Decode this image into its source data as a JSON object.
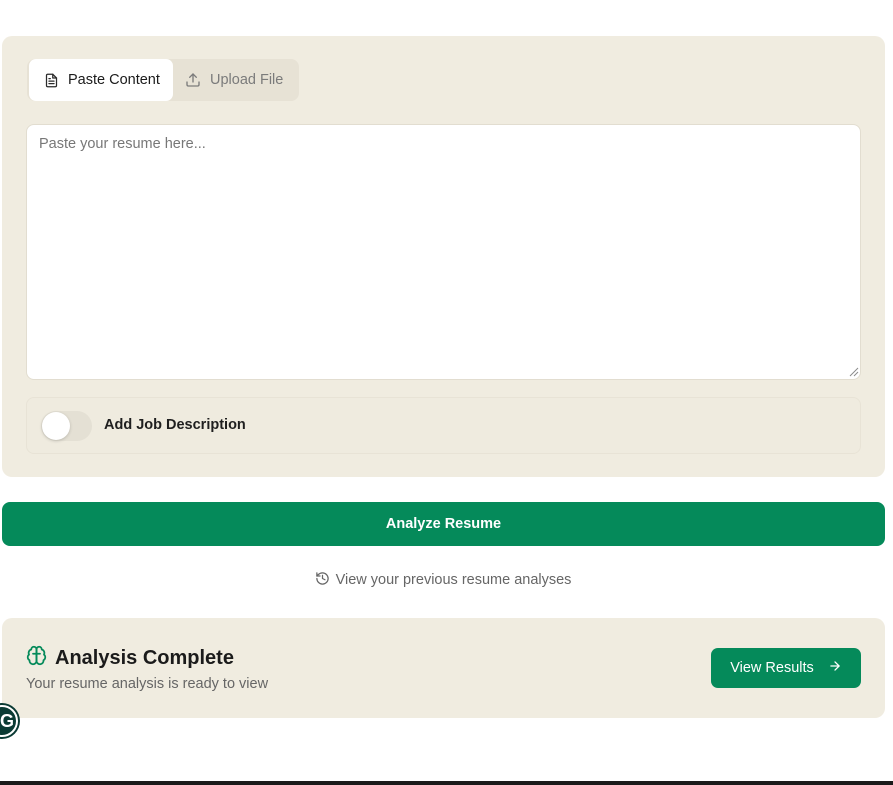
{
  "tabs": {
    "paste_label": "Paste Content",
    "paste_icon": "document-icon",
    "upload_label": "Upload File",
    "upload_icon": "upload-icon",
    "active": "Paste Content"
  },
  "resume_input": {
    "value": "",
    "placeholder": "Paste your resume here..."
  },
  "job_description": {
    "label": "Add Job Description",
    "enabled": false
  },
  "analyze_button": {
    "label": "Analyze Resume"
  },
  "history_link": {
    "label": "View your previous resume analyses",
    "icon": "history-icon"
  },
  "result": {
    "icon": "brain-icon",
    "title": "Analysis Complete",
    "subtitle": "Your resume analysis is ready to view",
    "button_label": "View Results",
    "button_icon": "arrow-right-icon"
  },
  "floating_badge": {
    "letter": "G"
  },
  "colors": {
    "accent": "#058a5a",
    "card_bg": "#f0ece0",
    "muted_text": "#666666"
  }
}
